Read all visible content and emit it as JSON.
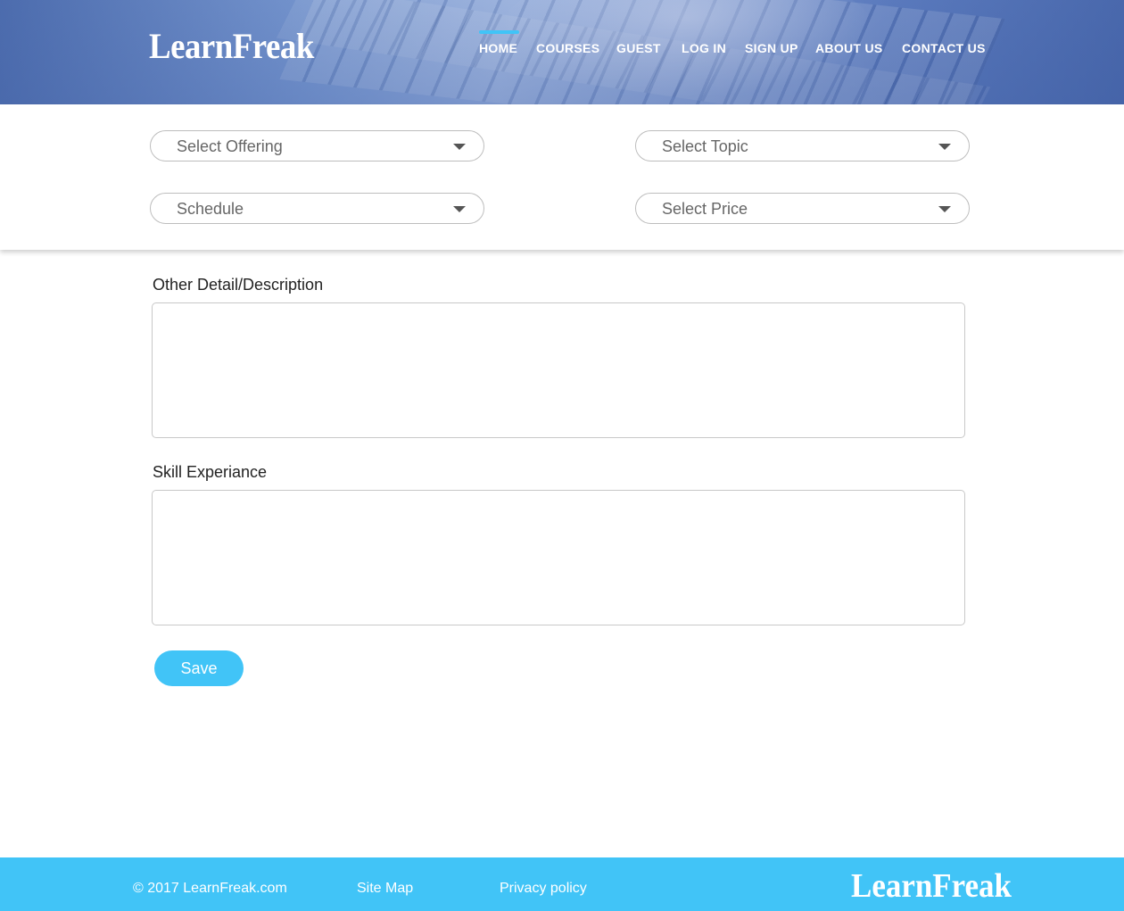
{
  "header": {
    "logo": "LearnFreak",
    "nav": [
      {
        "label": "HOME",
        "active": true
      },
      {
        "label": "COURSES",
        "active": false
      },
      {
        "label": "GUEST",
        "active": false
      },
      {
        "label": "LOG IN",
        "active": false
      },
      {
        "label": "SIGN UP",
        "active": false
      },
      {
        "label": "ABOUT US",
        "active": false
      },
      {
        "label": "CONTACT US",
        "active": false
      }
    ]
  },
  "filters": {
    "offering": {
      "placeholder": "Select Offering"
    },
    "topic": {
      "placeholder": "Select Topic"
    },
    "schedule": {
      "placeholder": "Schedule"
    },
    "price": {
      "placeholder": "Select Price"
    }
  },
  "form": {
    "description_label": "Other  Detail/Description",
    "description_value": "",
    "skill_label": "Skill Experiance",
    "skill_value": "",
    "save_label": "Save"
  },
  "footer": {
    "copyright": "© 2017 LearnFreak.com",
    "sitemap": "Site Map",
    "privacy": "Privacy policy",
    "logo": "LearnFreak"
  },
  "colors": {
    "accent": "#41c4f7",
    "header_blue": "#5f7fc2"
  }
}
